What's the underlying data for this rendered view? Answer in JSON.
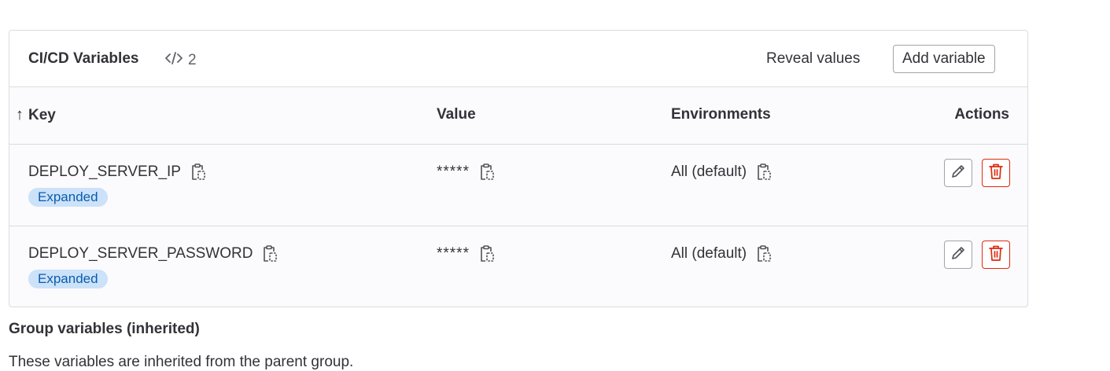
{
  "header": {
    "title": "CI/CD Variables",
    "count": "2",
    "reveal_label": "Reveal values",
    "add_label": "Add variable"
  },
  "table": {
    "columns": {
      "key": "Key",
      "value": "Value",
      "environments": "Environments",
      "actions": "Actions"
    },
    "sort_indicator": "↑",
    "rows": [
      {
        "key": "DEPLOY_SERVER_IP",
        "badge": "Expanded",
        "value": "*****",
        "environment": "All (default)"
      },
      {
        "key": "DEPLOY_SERVER_PASSWORD",
        "badge": "Expanded",
        "value": "*****",
        "environment": "All (default)"
      }
    ]
  },
  "group": {
    "title": "Group variables (inherited)",
    "description": "These variables are inherited from the parent group."
  },
  "colors": {
    "badge_bg": "#cbe2f9",
    "badge_text": "#0b5cad",
    "danger": "#dd2b0e",
    "border": "#dcdcde"
  }
}
